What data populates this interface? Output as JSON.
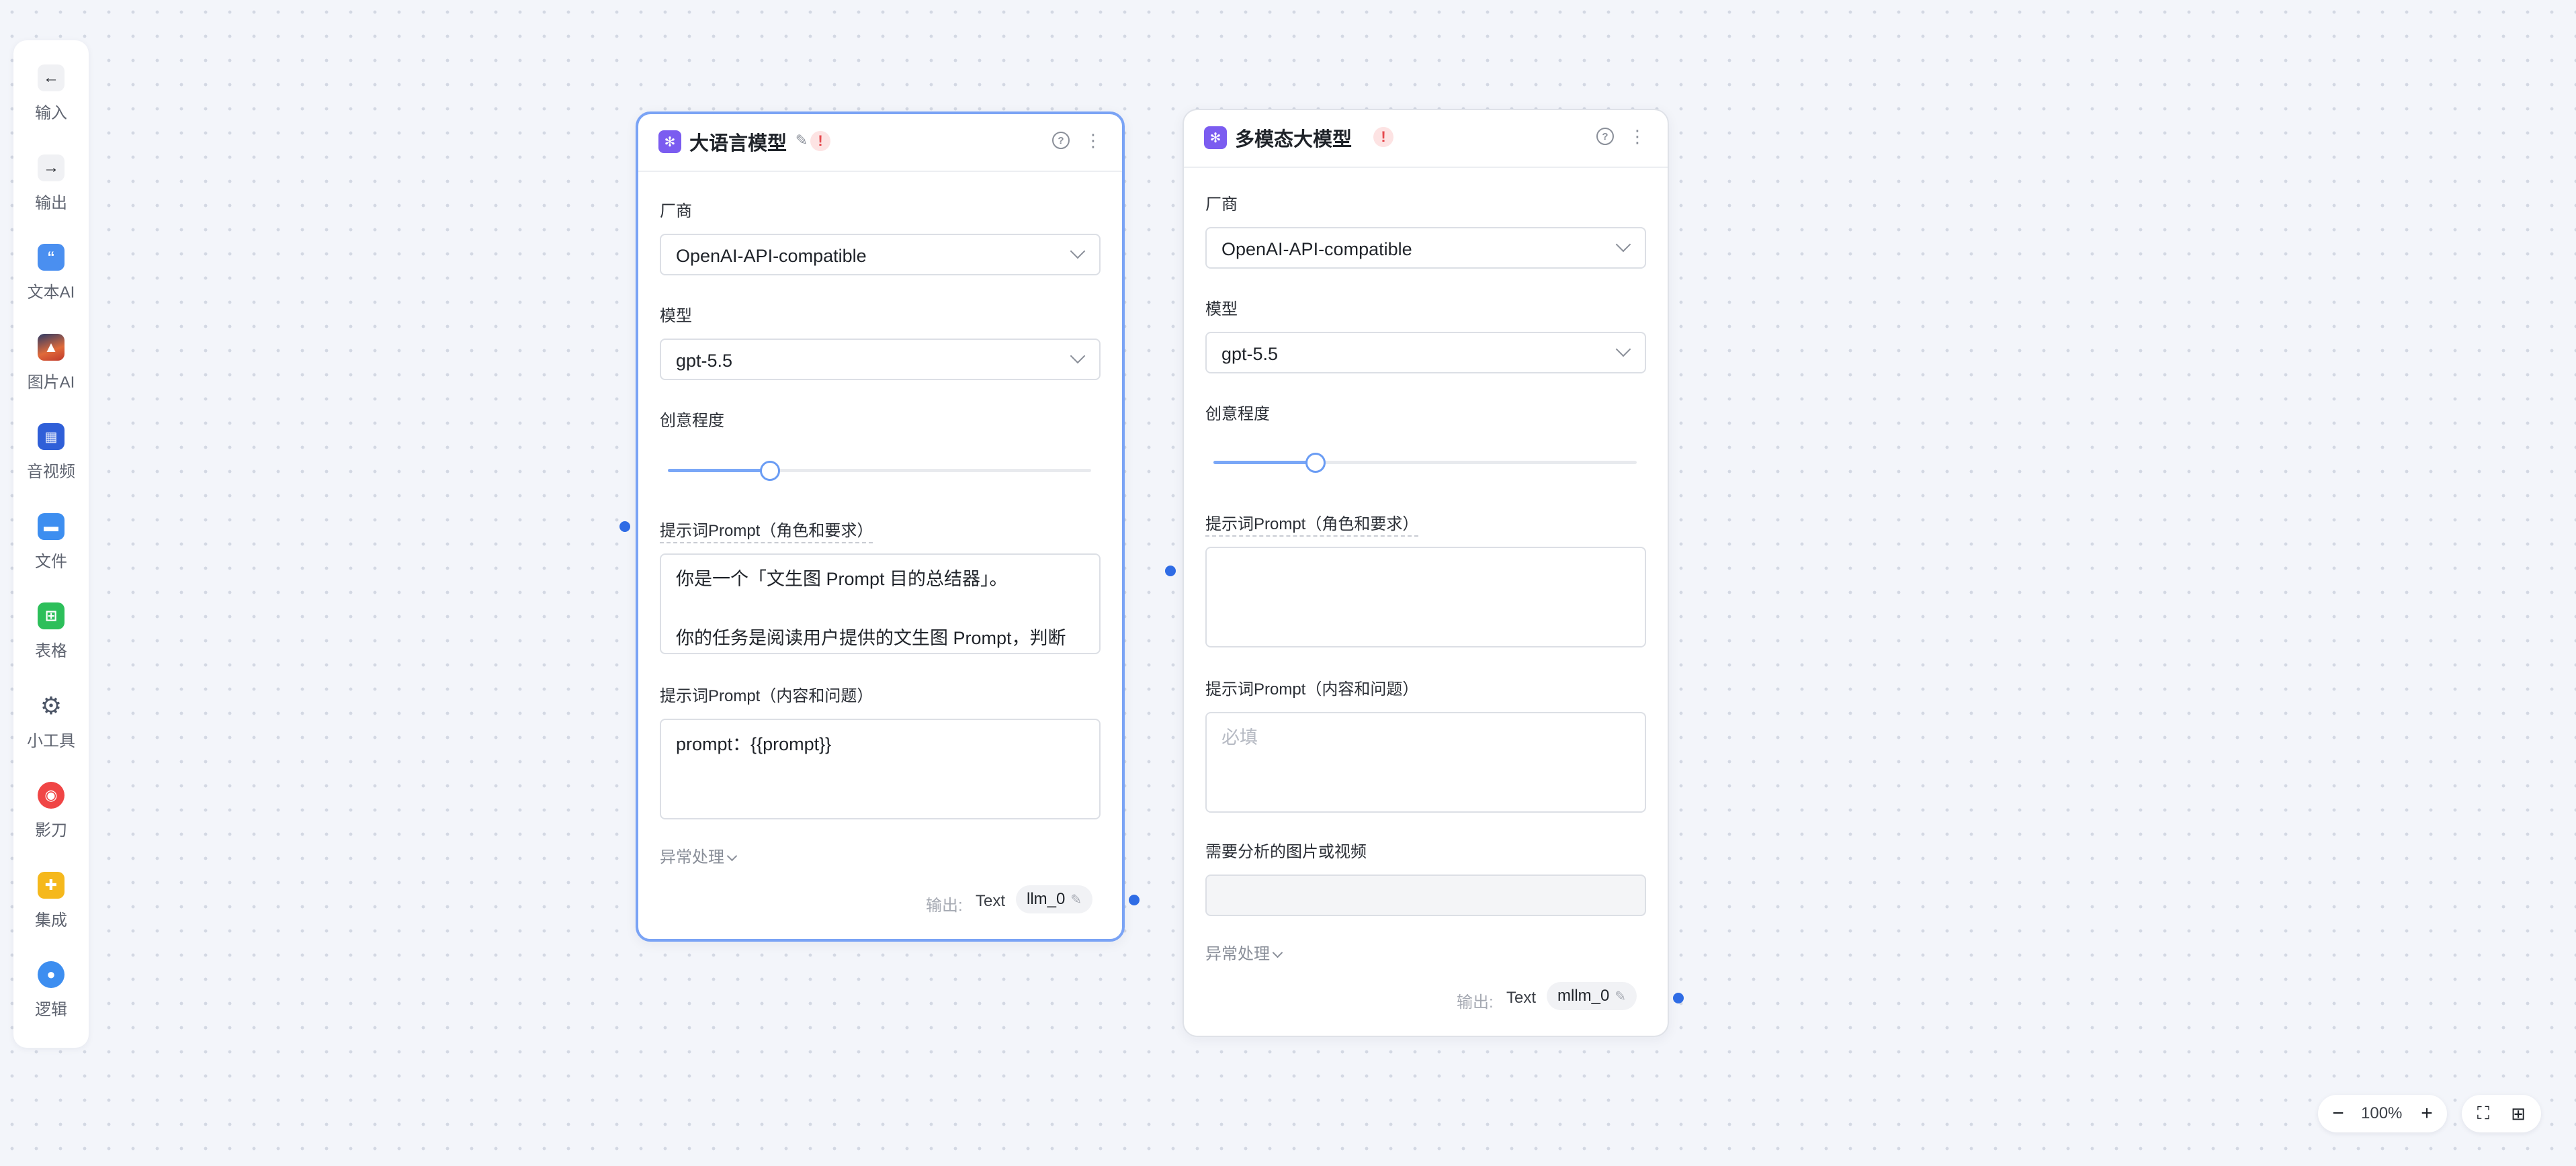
{
  "toolbar": {
    "items": [
      {
        "label": "输入",
        "icon": "arrow-left-icon",
        "color": "#f0f1f4"
      },
      {
        "label": "输出",
        "icon": "arrow-right-icon",
        "color": "#f0f1f4"
      },
      {
        "label": "文本AI",
        "icon": "quote-icon",
        "color": "#4a8ff0"
      },
      {
        "label": "图片AI",
        "icon": "image-icon",
        "color": "#e06a3a"
      },
      {
        "label": "音视频",
        "icon": "film-icon",
        "color": "#2f5fd8"
      },
      {
        "label": "文件",
        "icon": "folder-icon",
        "color": "#3d8ef0"
      },
      {
        "label": "表格",
        "icon": "table-icon",
        "color": "#2cbf5a"
      },
      {
        "label": "小工具",
        "icon": "gear-icon",
        "color": "#4c5566"
      },
      {
        "label": "影刀",
        "icon": "shadowbot-icon",
        "color": "#f04545"
      },
      {
        "label": "集成",
        "icon": "puzzle-icon",
        "color": "#f5b81c"
      },
      {
        "label": "逻辑",
        "icon": "bulb-icon",
        "color": "#3d8ef0"
      }
    ]
  },
  "nodes": {
    "llm": {
      "title": "大语言模型",
      "vendor_label": "厂商",
      "vendor_value": "OpenAI-API-compatible",
      "model_label": "模型",
      "model_value": "gpt-5.5",
      "creativity_label": "创意程度",
      "creativity_value": 0.24,
      "prompt_role_label": "提示词Prompt（角色和要求）",
      "prompt_role_lines": [
        "你是一个「文生图 Prompt 目的总结器」。",
        "",
        "你的任务是阅读用户提供的文生图 Prompt，判断"
      ],
      "prompt_content_label": "提示词Prompt（内容和问题）",
      "prompt_content_value": "prompt：{{prompt}}",
      "exception_label": "异常处理",
      "output_label": "输出:",
      "output_type": "Text",
      "output_var": "llm_0"
    },
    "mllm": {
      "title": "多模态大模型",
      "vendor_label": "厂商",
      "vendor_value": "OpenAI-API-compatible",
      "model_label": "模型",
      "model_value": "gpt-5.5",
      "creativity_label": "创意程度",
      "creativity_value": 0.24,
      "prompt_role_label": "提示词Prompt（角色和要求）",
      "prompt_content_label": "提示词Prompt（内容和问题）",
      "prompt_content_placeholder": "必填",
      "media_label": "需要分析的图片或视频",
      "exception_label": "异常处理",
      "output_label": "输出:",
      "output_type": "Text",
      "output_var": "mllm_0"
    }
  },
  "zoom": {
    "value": "100%"
  },
  "colors": {
    "accent": "#2f6ce5",
    "selected_border": "#7aa3f5",
    "node_icon": "#7b5cf0",
    "warning": "#e5484d"
  }
}
